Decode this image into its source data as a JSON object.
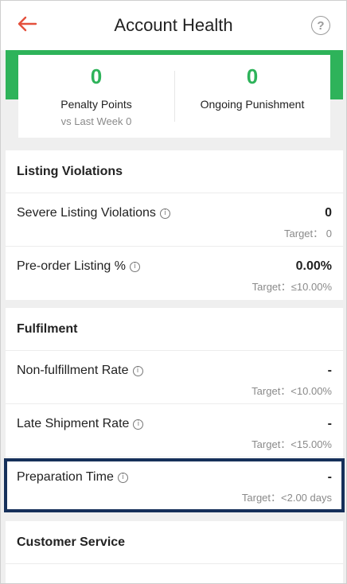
{
  "header": {
    "title": "Account Health",
    "back_icon": "arrow-left-icon",
    "help_label": "?",
    "accent": "#e4503c"
  },
  "summary": {
    "accent": "#2eb35a",
    "penalty": {
      "value": "0",
      "label": "Penalty Points",
      "sub": "vs Last Week 0"
    },
    "punishment": {
      "value": "0",
      "label": "Ongoing Punishment"
    }
  },
  "listing": {
    "title": "Listing Violations",
    "rows": [
      {
        "label": "Severe Listing Violations",
        "value": "0",
        "target": "Target： 0"
      },
      {
        "label": "Pre-order Listing %",
        "value": "0.00%",
        "target": "Target：≤10.00%"
      }
    ]
  },
  "fulfilment": {
    "title": "Fulfilment",
    "rows": [
      {
        "label": "Non-fulfillment Rate",
        "value": "-",
        "target": "Target：<10.00%"
      },
      {
        "label": "Late Shipment Rate",
        "value": "-",
        "target": "Target：<15.00%"
      },
      {
        "label": "Preparation Time",
        "value": "-",
        "target": "Target：<2.00 days"
      }
    ]
  },
  "customer_service": {
    "title": "Customer Service"
  },
  "info_glyph": "i"
}
